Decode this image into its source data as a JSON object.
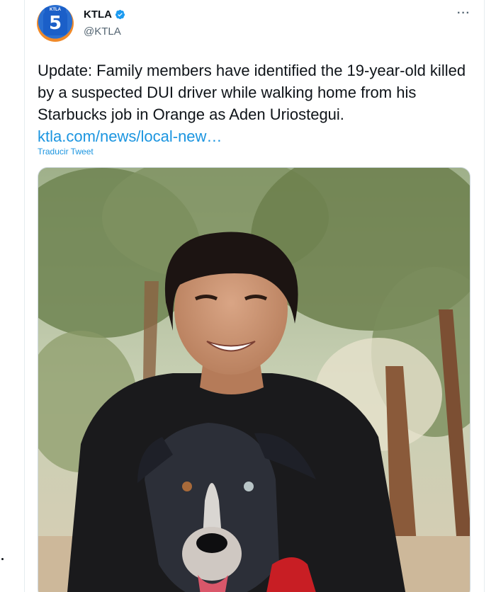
{
  "account": {
    "display_name": "KTLA",
    "handle": "@KTLA",
    "avatar_text": "5",
    "avatar_tag": "KTLA",
    "verified": true
  },
  "tweet": {
    "text_main": "Update: Family members have identified the 19-year-old killed by a suspected DUI driver while walking home from his Starbucks job in Orange as Aden Uriostegui. ",
    "link_text": "ktla.com/news/local-new…",
    "translate_label": "Traducir Tweet",
    "more_label": "···"
  },
  "colors": {
    "link": "#1b95e0",
    "text": "#0f1419",
    "muted": "#536471",
    "verified": "#1d9bf0"
  },
  "icons": {
    "verified": "verified-badge-icon",
    "more": "more-options-icon"
  }
}
